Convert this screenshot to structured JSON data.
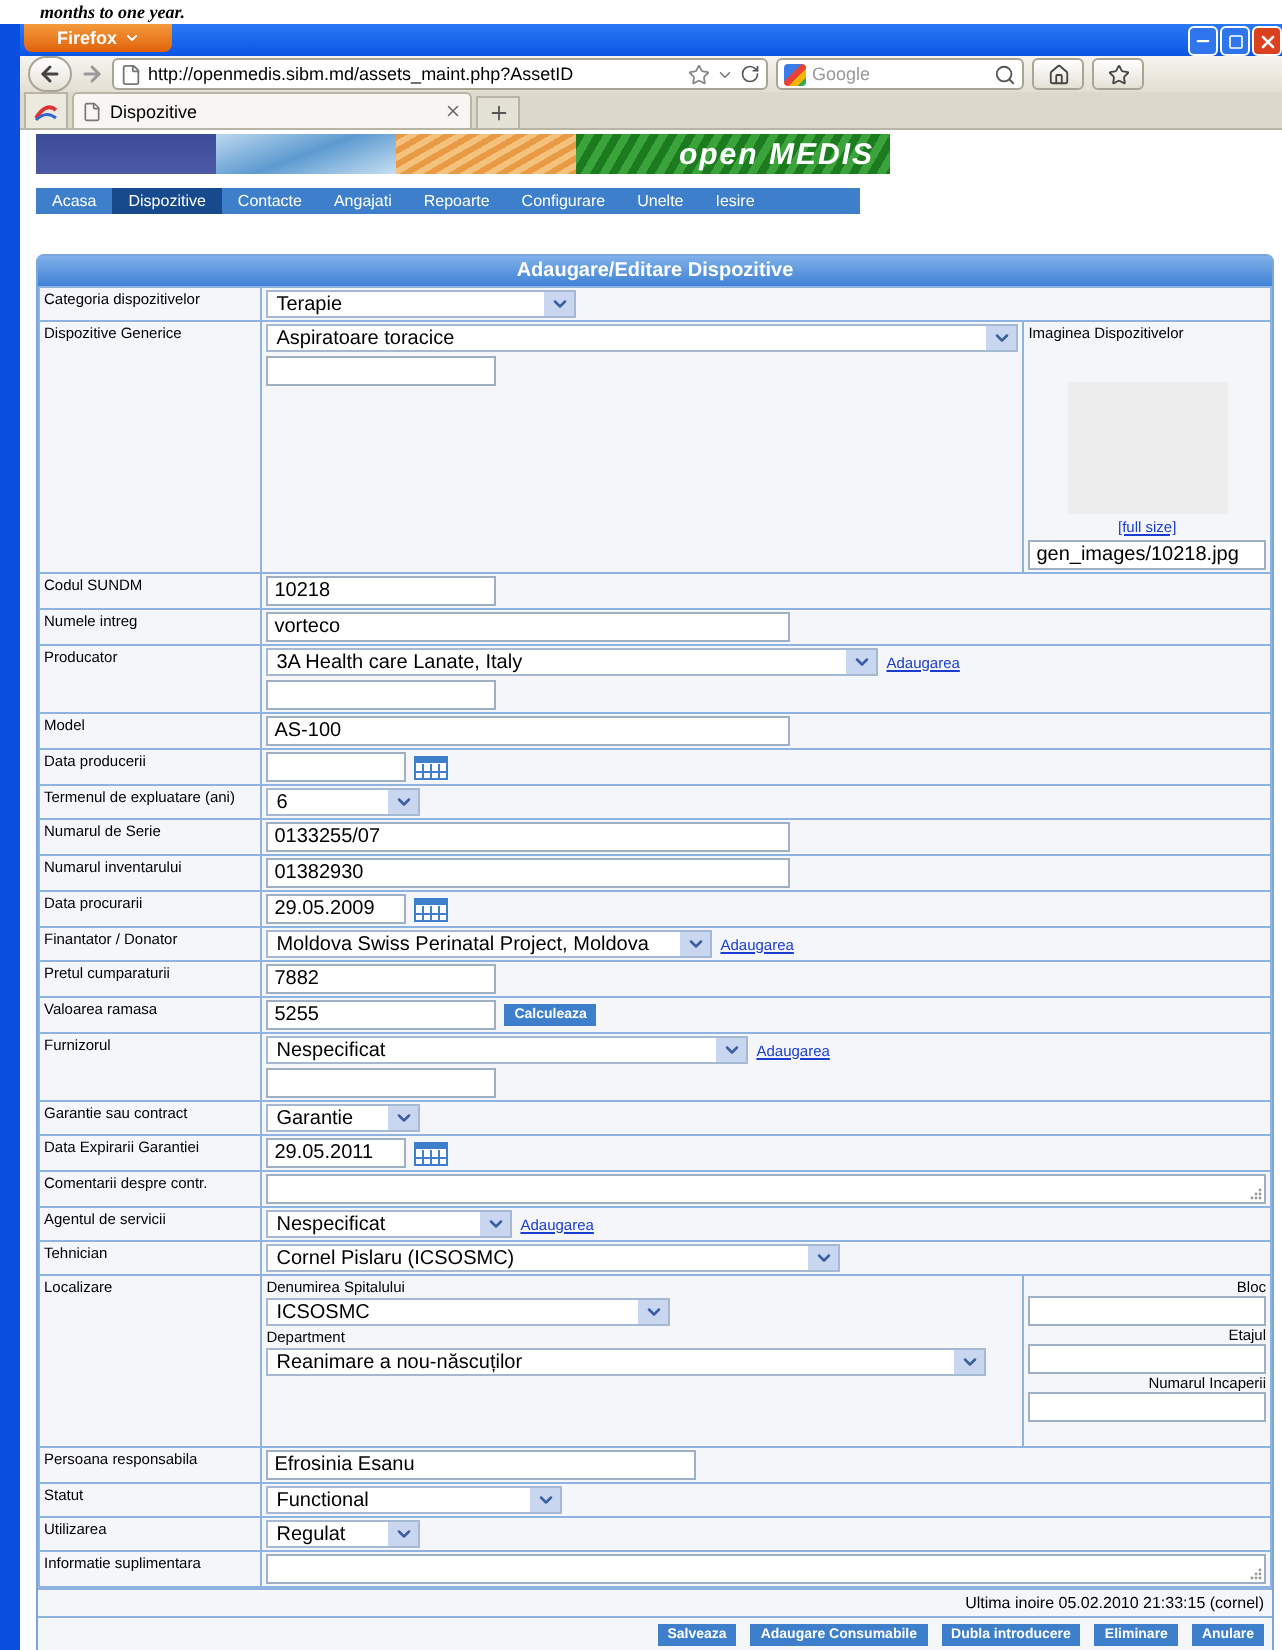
{
  "page_top_text": "months to one year.",
  "browser": {
    "menu_button": "Firefox",
    "url": "http://openmedis.sibm.md/assets_maint.php?AssetID",
    "search_placeholder": "Google",
    "tabs": [
      {
        "label": "Dispozitive",
        "selected": true
      }
    ]
  },
  "banner": {
    "logo": "open MEDIS"
  },
  "nav": [
    {
      "label": "Acasa",
      "selected": false
    },
    {
      "label": "Dispozitive",
      "selected": true
    },
    {
      "label": "Contacte",
      "selected": false
    },
    {
      "label": "Angajati",
      "selected": false
    },
    {
      "label": "Repoarte",
      "selected": false
    },
    {
      "label": "Configurare",
      "selected": false
    },
    {
      "label": "Unelte",
      "selected": false
    },
    {
      "label": "Iesire",
      "selected": false
    }
  ],
  "form": {
    "title": "Adaugare/Editare Dispozitive",
    "rows": [
      {
        "kind": "select",
        "label": "Categoria dispozitivelor",
        "value": "Terapie"
      },
      {
        "kind": "select_image",
        "label": "Dispozitive Generice",
        "value": "Aspiratoare toracice",
        "extra_input": true,
        "image_label": "Imaginea Dispozitivelor",
        "image_link": "[full size]",
        "image_path": "gen_images/10218.jpg"
      },
      {
        "kind": "text",
        "label": "Codul SUNDM",
        "value": "10218"
      },
      {
        "kind": "text",
        "label": "Numele intreg",
        "value": "vorteco"
      },
      {
        "kind": "select",
        "label": "Producator",
        "value": "3A Health care Lanate, Italy",
        "link": "Adaugarea",
        "extra_input": true
      },
      {
        "kind": "text",
        "label": "Model",
        "value": "AS-100"
      },
      {
        "kind": "date",
        "label": "Data producerii"
      },
      {
        "kind": "select",
        "label": "Termenul de expluatare (ani)",
        "value": "6"
      },
      {
        "kind": "text",
        "label": "Numarul de Serie",
        "value": "0133255/07"
      },
      {
        "kind": "text",
        "label": "Numarul inventarului",
        "value": "01382930"
      },
      {
        "kind": "date",
        "label": "Data procurarii",
        "value": "29.05.2009"
      },
      {
        "kind": "select",
        "label": "Finantator / Donator",
        "value": "Moldova Swiss Perinatal Project, Moldova",
        "link": "Adaugarea"
      },
      {
        "kind": "text",
        "label": "Pretul cumparaturii",
        "value": "7882"
      },
      {
        "kind": "text_button",
        "label": "Valoarea ramasa",
        "value": "5255",
        "button": "Calculeaza"
      },
      {
        "kind": "select",
        "label": "Furnizorul",
        "value": "Nespecificat",
        "link": "Adaugarea",
        "extra_input": true
      },
      {
        "kind": "select",
        "label": "Garantie sau contract",
        "value": "Garantie"
      },
      {
        "kind": "date",
        "label": "Data Expirarii Garantiei",
        "value": "29.05.2011"
      },
      {
        "kind": "textarea",
        "label": "Comentarii despre contr."
      },
      {
        "kind": "select",
        "label": "Agentul de servicii",
        "value": "Nespecificat",
        "link": "Adaugarea"
      },
      {
        "kind": "select",
        "label": "Tehnician",
        "value": "Cornel Pislaru (ICSOSMC)"
      },
      {
        "kind": "location",
        "label": "Localizare",
        "hospital_label": "Denumirea Spitalului",
        "hospital": "ICSOSMC",
        "department_label": "Department",
        "department": "Reanimare a nou-născuților",
        "fields": [
          {
            "label": "Bloc"
          },
          {
            "label": "Etajul"
          },
          {
            "label": "Numarul Incaperii"
          }
        ]
      },
      {
        "kind": "text",
        "label": "Persoana responsabila",
        "value": "Efrosinia Esanu"
      },
      {
        "kind": "select",
        "label": "Statut",
        "value": "Functional"
      },
      {
        "kind": "select",
        "label": "Utilizarea",
        "value": "Regulat"
      },
      {
        "kind": "textarea",
        "label": "Informatie suplimentara"
      }
    ],
    "last_update": "Ultima inoire 05.02.2010 21:33:15  (cornel)",
    "buttons": [
      "Salveaza",
      "Adaugare Consumabile",
      "Dubla introducere",
      "Eliminare",
      "Anulare"
    ]
  }
}
